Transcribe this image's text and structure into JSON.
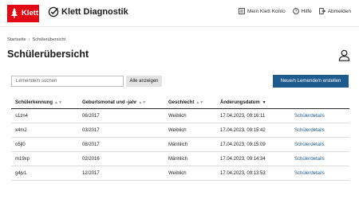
{
  "header": {
    "logo_text": "Klett",
    "title": "Klett Diagnostik",
    "nav": {
      "account": "Mein Klett Konto",
      "help": "Hilfe",
      "logout": "Abmelden"
    }
  },
  "breadcrumb": {
    "home": "Startseite",
    "current": "Schülerübersicht"
  },
  "page": {
    "title": "Schülerübersicht"
  },
  "toolbar": {
    "search_placeholder": "Lernende/n suchen",
    "show_all_label": "Alle anzeigen",
    "new_label": "Neue/n Lernende/n erstellen"
  },
  "table": {
    "columns": [
      "Schülerkennung",
      "Geburtsmonat und -jahr",
      "Geschlecht",
      "Änderungsdatum"
    ],
    "rows": [
      {
        "id": "s1zn4",
        "birth": "06/2017",
        "gender": "Weiblich",
        "changed": "17.04.2023, 09:16:11",
        "action": "Schülerdetails"
      },
      {
        "id": "x4m2",
        "birth": "03/2017",
        "gender": "Weiblich",
        "changed": "17.04.2023, 09:15:42",
        "action": "Schülerdetails"
      },
      {
        "id": "o5jl0",
        "birth": "08/2017",
        "gender": "Männlich",
        "changed": "17.04.2023, 09:15:09",
        "action": "Schülerdetails"
      },
      {
        "id": "m19xp",
        "birth": "02/2016",
        "gender": "Männlich",
        "changed": "17.04.2023, 09:14:34",
        "action": "Schülerdetails"
      },
      {
        "id": "g4jv1",
        "birth": "12/2017",
        "gender": "Weiblich",
        "changed": "17.04.2023, 09:13:53",
        "action": "Schülerdetails"
      }
    ]
  },
  "colors": {
    "brand_red": "#e30613",
    "primary_blue": "#1f5a8c",
    "secondary_button": "#e3e3e3"
  },
  "icons": [
    "klett-logo-icon",
    "checkmark-badge-icon",
    "account-icon",
    "help-icon",
    "logout-icon",
    "user-icon",
    "sort-icon",
    "sort-desc-icon"
  ]
}
